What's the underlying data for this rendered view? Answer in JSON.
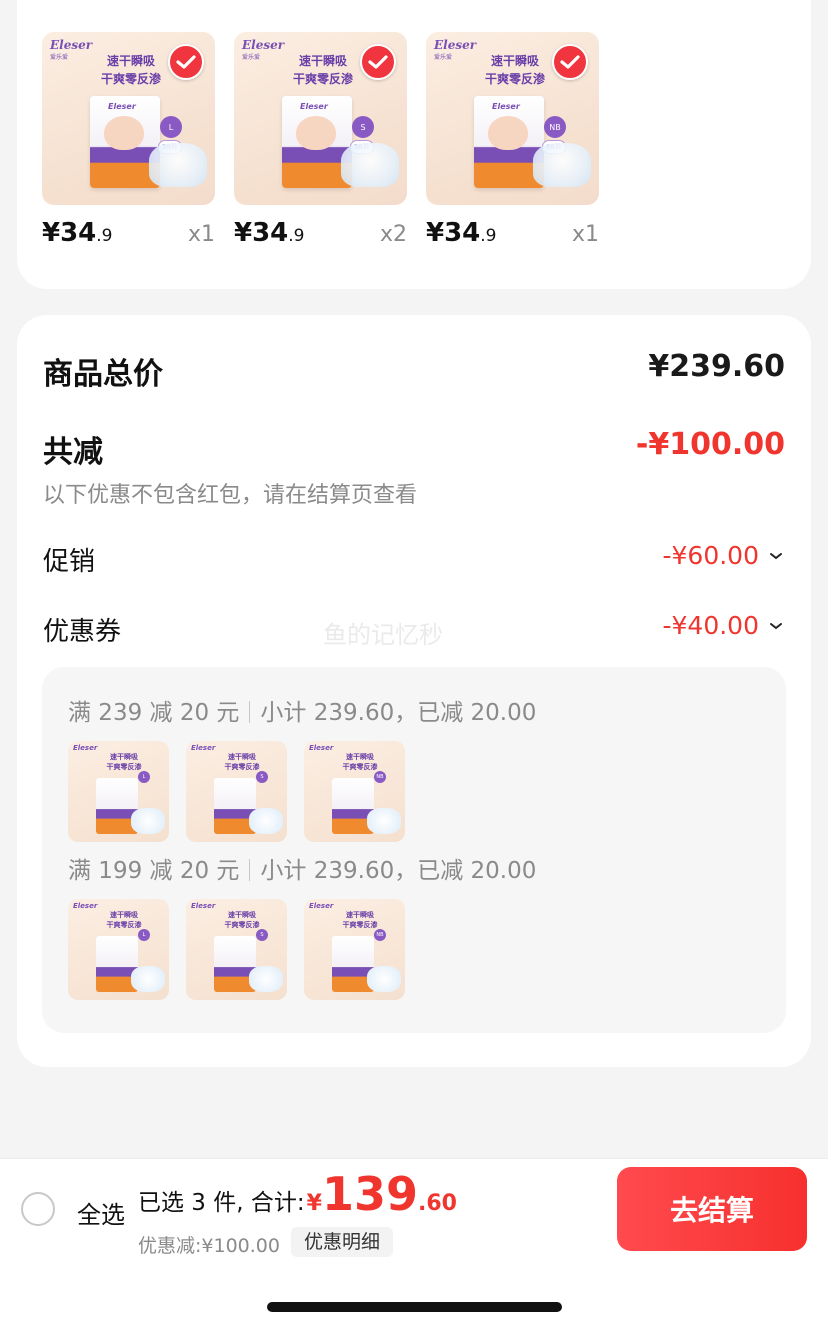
{
  "products": [
    {
      "brand": "Eleser",
      "brand_sub": "爱乐爱",
      "slogan_1": "速干瞬吸",
      "slogan_2": "干爽零反渗",
      "size": "L",
      "count": "38片",
      "price_int": "¥34",
      "price_dec": ".9",
      "qty": "x1"
    },
    {
      "brand": "Eleser",
      "brand_sub": "爱乐爱",
      "slogan_1": "速干瞬吸",
      "slogan_2": "干爽零反渗",
      "size": "S",
      "count": "56片",
      "price_int": "¥34",
      "price_dec": ".9",
      "qty": "x2"
    },
    {
      "brand": "Eleser",
      "brand_sub": "爱乐爱",
      "slogan_1": "速干瞬吸",
      "slogan_2": "干爽零反渗",
      "size": "NB",
      "count": "66片",
      "price_int": "¥34",
      "price_dec": ".9",
      "qty": "x1"
    }
  ],
  "totals": {
    "goods_total_label": "商品总价",
    "goods_total_value": "¥239.60",
    "reduction_label": "共减",
    "reduction_value": "-¥100.00",
    "reduction_note": "以下优惠不包含红包，请在结算页查看",
    "promo_label": "促销",
    "promo_value": "-¥60.00",
    "coupon_label": "优惠券",
    "coupon_value": "-¥40.00",
    "watermark": "鱼的记忆秒"
  },
  "promos": [
    {
      "rule": "满 239 减 20 元",
      "summary": "小计 239.60，已减 20.00",
      "sizes": [
        "L",
        "S",
        "NB"
      ]
    },
    {
      "rule": "满 199 减 20 元",
      "summary": "小计 239.60，已减 20.00",
      "sizes": [
        "L",
        "S",
        "NB"
      ]
    }
  ],
  "thumb": {
    "brand": "Eleser",
    "slogan_1": "速干瞬吸",
    "slogan_2": "干爽零反渗"
  },
  "bottom_bar": {
    "select_all": "全选",
    "selected_text": "已选 3 件, 合计:",
    "total_currency": "¥",
    "total_int": "139",
    "total_dec": ".60",
    "discount_text": "优惠减:¥100.00",
    "detail_button": "优惠明细",
    "checkout_button": "去结算"
  },
  "colors": {
    "accent": "#f0352e",
    "brand_purple": "#7a4fb5"
  }
}
